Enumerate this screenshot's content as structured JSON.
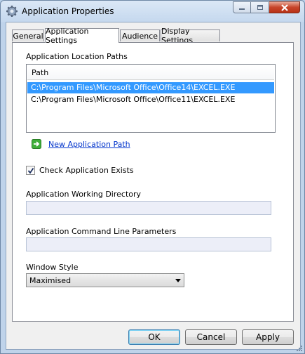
{
  "window": {
    "title": "Application Properties",
    "icon": "gear-icon",
    "caption_buttons": [
      "minimize",
      "maximize",
      "close"
    ]
  },
  "tabs": [
    {
      "label": "General",
      "active": false
    },
    {
      "label": "Application Settings",
      "active": true
    },
    {
      "label": "Audience",
      "active": false
    },
    {
      "label": "Display Settings",
      "active": false
    }
  ],
  "paths_section": {
    "label": "Application Location Paths",
    "column_header": "Path",
    "rows": [
      {
        "path": "C:\\Program Files\\Microsoft Office\\Office14\\EXCEL.EXE",
        "selected": true
      },
      {
        "path": "C:\\Program Files\\Microsoft Office\\Office11\\EXCEL.EXE",
        "selected": false
      }
    ],
    "new_path_link": "New Application Path"
  },
  "check_exists": {
    "label": "Check Application Exists",
    "checked": true
  },
  "working_directory": {
    "label": "Application Working Directory",
    "value": ""
  },
  "command_line": {
    "label": "Application Command Line Parameters",
    "value": ""
  },
  "window_style": {
    "label": "Window Style",
    "value": "Maximised"
  },
  "buttons": {
    "ok": "OK",
    "cancel": "Cancel",
    "apply": "Apply"
  },
  "colors": {
    "selection": "#3399ff",
    "link": "#0033cc",
    "field_bg": "#eceef8"
  }
}
